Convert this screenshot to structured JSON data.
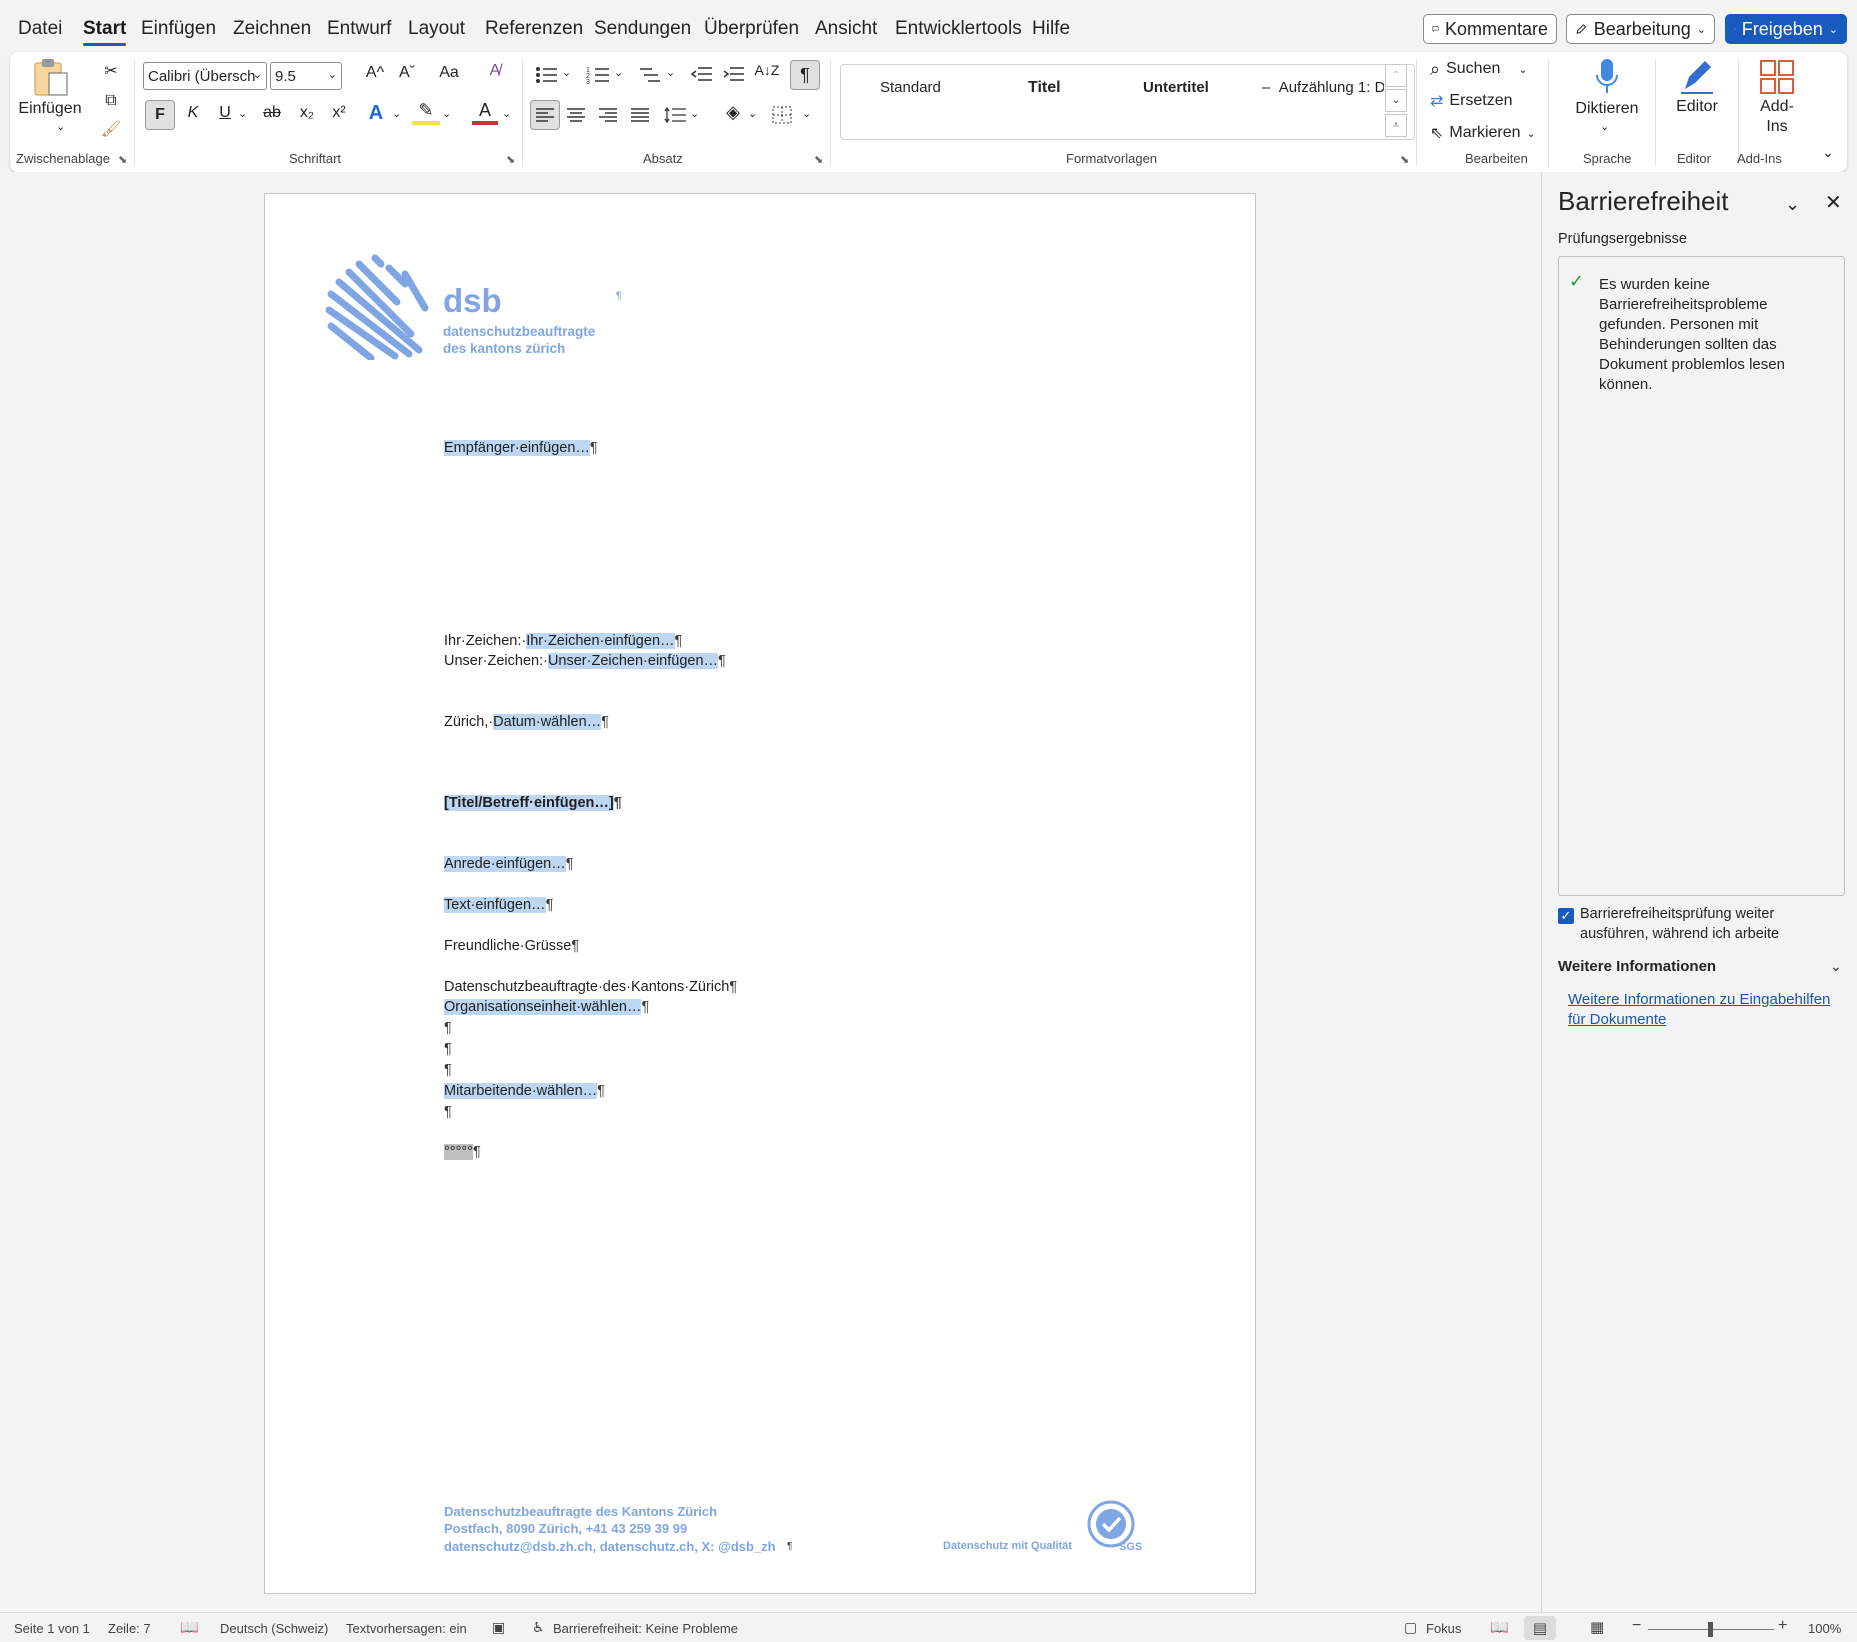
{
  "menu": {
    "tabs": [
      "Datei",
      "Start",
      "Einfügen",
      "Zeichnen",
      "Entwurf",
      "Layout",
      "Referenzen",
      "Sendungen",
      "Überprüfen",
      "Ansicht",
      "Entwicklertools",
      "Hilfe"
    ],
    "active_tab": "Start",
    "comments_label": "Kommentare",
    "editing_label": "Bearbeitung",
    "share_label": "Freigeben"
  },
  "ribbon": {
    "clipboard": {
      "paste_label": "Einfügen",
      "group_label": "Zwischenablage"
    },
    "font": {
      "font_name": "Calibri (Übersch",
      "font_size": "9.5",
      "bold": "F",
      "italic": "K",
      "underline": "U",
      "strike": "ab",
      "subscript": "x₂",
      "superscript": "x²",
      "grow": "A^",
      "shrink": "Aˇ",
      "case": "Aa",
      "font_color": "A",
      "group_label": "Schriftart"
    },
    "paragraph": {
      "group_label": "Absatz",
      "pilcrow": "¶"
    },
    "styles": {
      "items": [
        "Standard",
        "Titel",
        "Untertitel",
        "Aufzählung 1: D:"
      ],
      "group_label": "Formatvorlagen"
    },
    "editing": {
      "find": "Suchen",
      "replace": "Ersetzen",
      "select": "Markieren",
      "group_label": "Bearbeiten"
    },
    "voice": {
      "dictate": "Diktieren",
      "group_label": "Sprache"
    },
    "editor": {
      "label": "Editor",
      "group_label": "Editor"
    },
    "addins": {
      "label_line1": "Add-",
      "label_line2": "Ins",
      "group_label": "Add-Ins"
    }
  },
  "document": {
    "logo": {
      "name": "dsb",
      "line1": "datenschutzbeauftragte",
      "line2": "des kantons zürich"
    },
    "recipient": "Empfänger·einfügen…",
    "ref_yours_label": "Ihr·Zeichen:·",
    "ref_yours_value": "Ihr·Zeichen·einfügen…",
    "ref_ours_label": "Unser·Zeichen:·",
    "ref_ours_value": "Unser·Zeichen·einfügen…",
    "date_label": "Zürich,·",
    "date_value": "Datum·wählen…",
    "subject": "[Titel/Betreff·einfügen…]",
    "salutation": "Anrede·einfügen…",
    "body": "Text·einfügen…",
    "closing": "Freundliche·Grüsse",
    "org_name": "Datenschutzbeauftragte·des·Kantons·Zürich",
    "org_unit": "Organisationseinheit·wählen…",
    "staff": "Mitarbeitende·wählen…",
    "field_placeholder": "°°°°°",
    "pilcrow": "¶",
    "footer": {
      "line1": "Datenschutzbeauftragte des Kantons Zürich",
      "line2": "Postfach, 8090 Zürich, +41 43 259 39 99",
      "line3": "datenschutz@dsb.zh.ch, datenschutz.ch, X: @dsb_zh",
      "quality": "Datenschutz mit Qualität",
      "sgs": "SGS"
    }
  },
  "pane": {
    "title": "Barrierefreiheit",
    "results_label": "Prüfungsergebnisse",
    "message": "Es wurden keine Barrierefreiheitsprobleme gefunden. Personen mit Behinderungen sollten das Dokument problemlos lesen können.",
    "keep_running_line1": "Barrierefreiheitsprüfung weiter",
    "keep_running_line2": "ausführen, während ich arbeite",
    "more_info_heading": "Weitere Informationen",
    "more_info_link": "Weitere Informationen zu Eingabehilfen für Dokumente"
  },
  "status": {
    "page": "Seite 1 von 1",
    "line": "Zeile: 7",
    "language": "Deutsch (Schweiz)",
    "predictions": "Textvorhersagen: ein",
    "accessibility": "Barrierefreiheit: Keine Probleme",
    "focus": "Fokus",
    "zoom": "100%"
  },
  "colors": {
    "accent": "#185abd",
    "highlight": "#bdd6f2",
    "logo": "#7fa5e3"
  }
}
